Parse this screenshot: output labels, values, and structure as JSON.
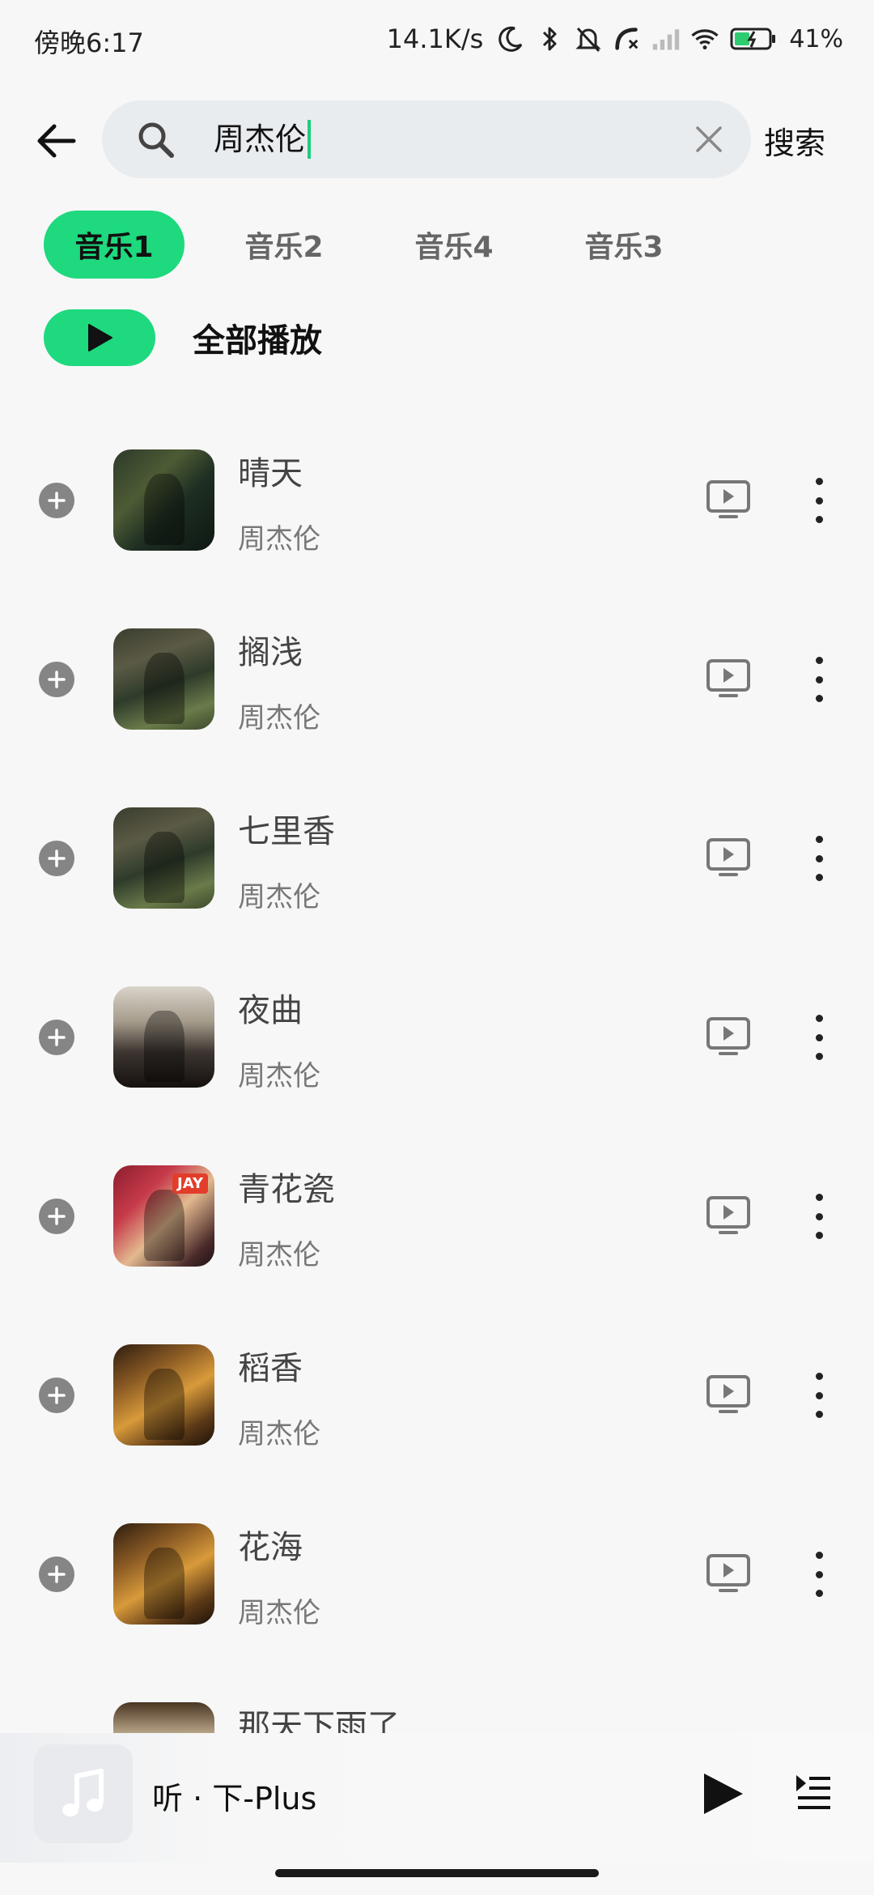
{
  "status_bar": {
    "time": "傍晚6:17",
    "net_speed": "14.1K/s",
    "battery": "41%",
    "icons": [
      "moon-icon",
      "bluetooth-icon",
      "mute-icon",
      "call-icon",
      "signal-icon",
      "wifi-icon",
      "battery-icon"
    ]
  },
  "search": {
    "query": "周杰伦",
    "submit_label": "搜索",
    "accent_color": "#1ed97e"
  },
  "tabs": [
    {
      "label": "音乐1",
      "active": true
    },
    {
      "label": "音乐2",
      "active": false
    },
    {
      "label": "音乐4",
      "active": false
    },
    {
      "label": "音乐3",
      "active": false
    }
  ],
  "play_all": {
    "label": "全部播放"
  },
  "songs": [
    {
      "title": "晴天",
      "artist": "周杰伦"
    },
    {
      "title": "搁浅",
      "artist": "周杰伦"
    },
    {
      "title": "七里香",
      "artist": "周杰伦"
    },
    {
      "title": "夜曲",
      "artist": "周杰伦"
    },
    {
      "title": "青花瓷",
      "artist": "周杰伦",
      "cover_tag": "JAY"
    },
    {
      "title": "稻香",
      "artist": "周杰伦"
    },
    {
      "title": "花海",
      "artist": "周杰伦"
    },
    {
      "title": "那天下雨了",
      "artist": ""
    }
  ],
  "mini_player": {
    "title": "听 · 下-Plus"
  }
}
